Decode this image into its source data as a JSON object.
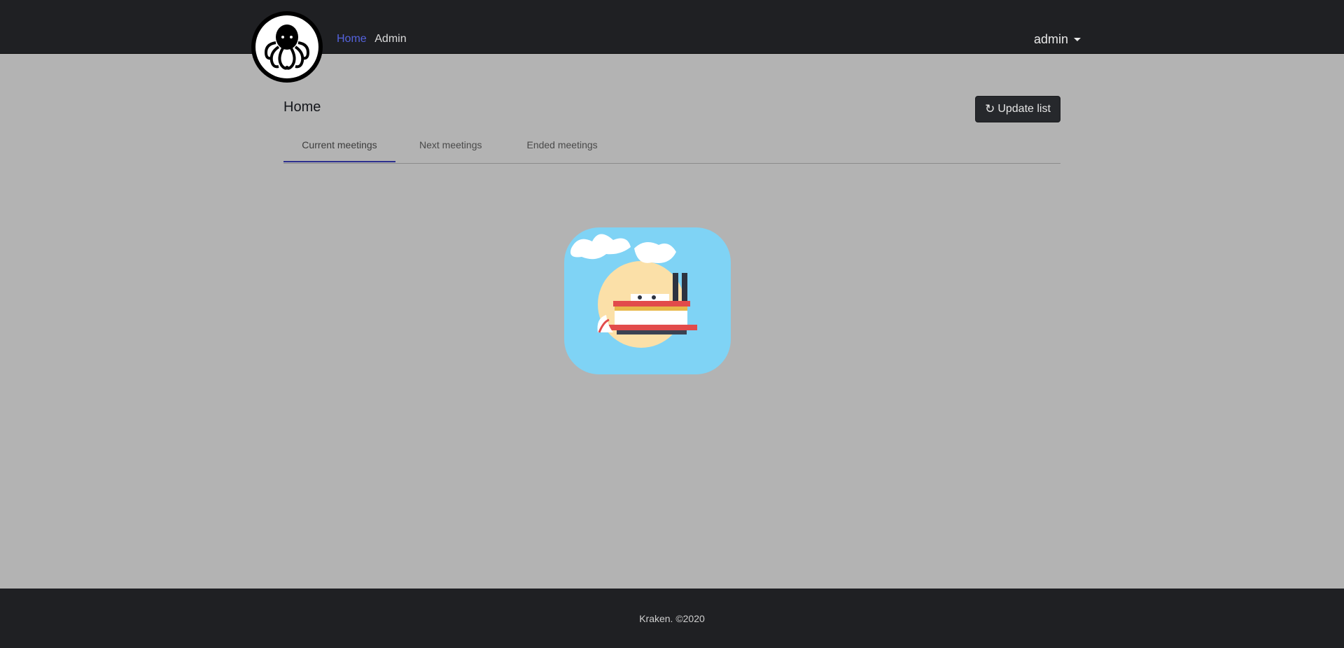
{
  "navbar": {
    "links": [
      {
        "label": "Home",
        "active": true
      },
      {
        "label": "Admin",
        "active": false
      }
    ],
    "user_menu": "admin",
    "logo_icon": "kraken-octopus-icon"
  },
  "main": {
    "title": "Home",
    "update_button": {
      "label": "Update list",
      "icon": "refresh-icon"
    },
    "tabs": [
      {
        "label": "Current meetings",
        "active": true
      },
      {
        "label": "Next meetings",
        "active": false
      },
      {
        "label": "Ended meetings",
        "active": false
      }
    ],
    "illustration": "steamboat-illustration"
  },
  "footer": {
    "text": "Kraken. ©2020"
  },
  "colors": {
    "navbar_bg": "#1f2023",
    "page_bg": "#b3b3b3",
    "active_link": "#5563de",
    "tab_underline": "#2c2f8e"
  }
}
